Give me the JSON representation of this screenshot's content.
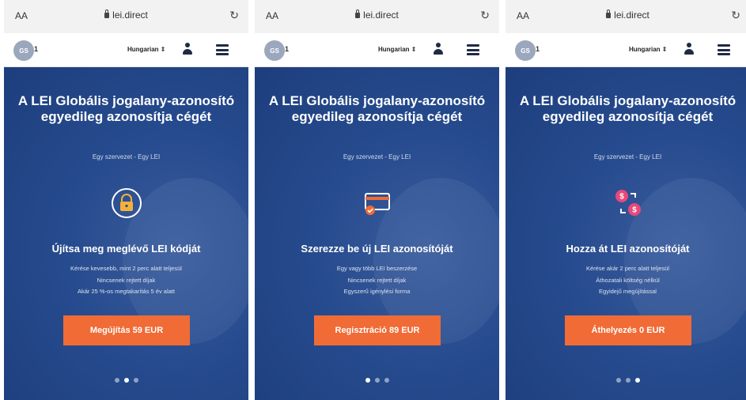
{
  "browser": {
    "text_size": "AA",
    "url": "lei.direct"
  },
  "nav": {
    "logo": "GS",
    "logo_suffix": "1",
    "language": "Hungarian ⇕"
  },
  "hero": {
    "title": "A LEI Globális jogalany-azonosító egyedileg azonosítja cégét",
    "subtitle": "Egy szervezet - Egy LEI"
  },
  "slides": [
    {
      "icon": "padlock-icon",
      "heading": "Újítsa meg meglévő LEI kódját",
      "features": [
        "Kérése kevesebb, mint 2 perc alatt teljesül",
        "Nincsenek rejtett díjak",
        "Akár 25 %-os megtakarítás 5 év alatt"
      ],
      "button": "Megújítás 59 EUR",
      "active_dot": 1
    },
    {
      "icon": "credit-card-check-icon",
      "heading": "Szerezze be új LEI azonosítóját",
      "features": [
        "Egy vagy több LEI beszerzése",
        "Nincsenek rejtett díjak",
        "Egyszerű igénylési forma"
      ],
      "button": "Regisztráció 89 EUR",
      "active_dot": 0
    },
    {
      "icon": "currency-transfer-icon",
      "heading": "Hozza át LEI azonosítóját",
      "features": [
        "Kérése akár 2 perc alatt teljesül",
        "Áthozatali költség nélkül",
        "Egyidejű megújítással"
      ],
      "button": "Áthelyezés 0 EUR",
      "active_dot": 2
    }
  ],
  "colors": {
    "hero": "#1d3e7d",
    "accent": "#f06b35",
    "icon_pink": "#e8487a",
    "icon_yellow": "#f4b13a"
  }
}
